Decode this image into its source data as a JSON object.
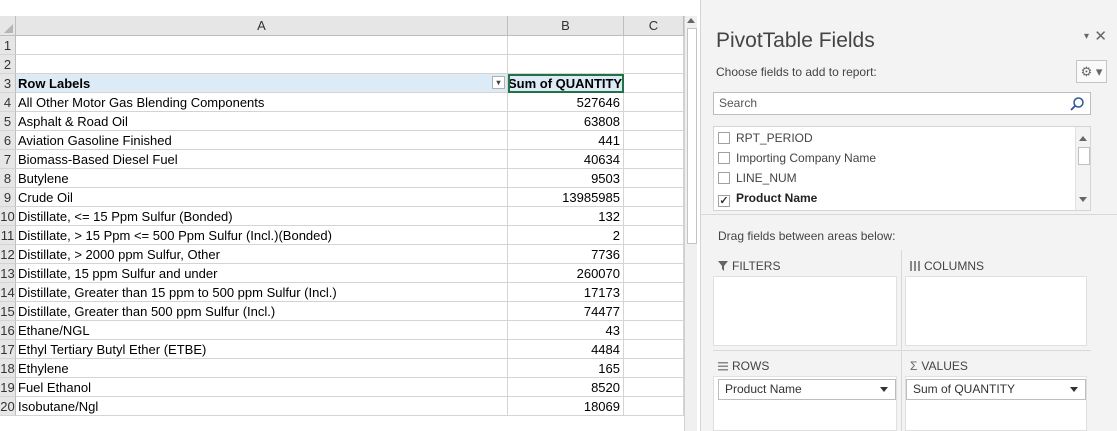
{
  "sheet": {
    "columns": [
      "A",
      "B",
      "C"
    ],
    "rows": [
      {
        "num": "1",
        "a": "",
        "b": ""
      },
      {
        "num": "2",
        "a": "",
        "b": ""
      },
      {
        "num": "3",
        "a": "Row Labels",
        "b": "Sum of QUANTITY"
      },
      {
        "num": "4",
        "a": "All Other Motor Gas Blending Components",
        "b": "527646"
      },
      {
        "num": "5",
        "a": "Asphalt & Road Oil",
        "b": "63808"
      },
      {
        "num": "6",
        "a": "Aviation Gasoline Finished",
        "b": "441"
      },
      {
        "num": "7",
        "a": "Biomass-Based Diesel Fuel",
        "b": "40634"
      },
      {
        "num": "8",
        "a": "Butylene",
        "b": "9503"
      },
      {
        "num": "9",
        "a": "Crude Oil",
        "b": "13985985"
      },
      {
        "num": "10",
        "a": "Distillate, <= 15 Ppm Sulfur (Bonded)",
        "b": "132"
      },
      {
        "num": "11",
        "a": "Distillate, > 15 Ppm <= 500 Ppm Sulfur (Incl.)(Bonded)",
        "b": "2"
      },
      {
        "num": "12",
        "a": "Distillate, > 2000 ppm Sulfur, Other",
        "b": "7736"
      },
      {
        "num": "13",
        "a": "Distillate, 15 ppm Sulfur and under",
        "b": "260070"
      },
      {
        "num": "14",
        "a": "Distillate, Greater than 15 ppm to 500 ppm Sulfur (Incl.)",
        "b": "17173"
      },
      {
        "num": "15",
        "a": "Distillate, Greater than 500 ppm Sulfur (Incl.)",
        "b": "74477"
      },
      {
        "num": "16",
        "a": "Ethane/NGL",
        "b": "43"
      },
      {
        "num": "17",
        "a": "Ethyl Tertiary Butyl Ether (ETBE)",
        "b": "4484"
      },
      {
        "num": "18",
        "a": "Ethylene",
        "b": "165"
      },
      {
        "num": "19",
        "a": "Fuel Ethanol",
        "b": "8520"
      },
      {
        "num": "20",
        "a": "Isobutane/Ngl",
        "b": "18069"
      }
    ]
  },
  "panel": {
    "title": "PivotTable Fields",
    "close_icon": "✕",
    "menu_icon": "▾",
    "choose_label": "Choose fields to add to report:",
    "gear_label": "⚙ ▾",
    "search_placeholder": "Search",
    "fields": [
      {
        "label": "RPT_PERIOD",
        "checked": false
      },
      {
        "label": "Importing Company Name",
        "checked": false
      },
      {
        "label": "LINE_NUM",
        "checked": false
      },
      {
        "label": "Product Name",
        "checked": true
      }
    ],
    "drag_label": "Drag fields between areas below:",
    "filters_label": "FILTERS",
    "columns_label": "COLUMNS",
    "rows_label": "ROWS",
    "values_label": "VALUES",
    "rows_value": "Product Name",
    "values_value": "Sum of QUANTITY"
  }
}
